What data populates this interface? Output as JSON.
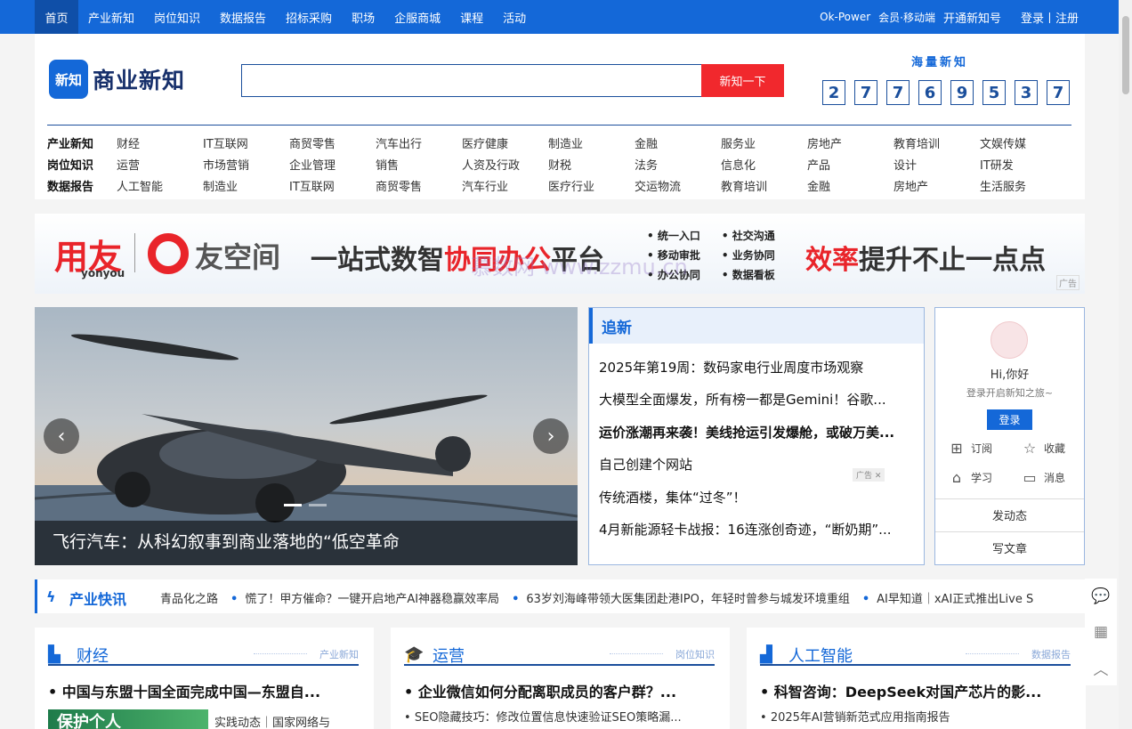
{
  "topnav": {
    "home": "首页",
    "links": [
      "产业新知",
      "岗位知识",
      "数据报告",
      "招标采购",
      "职场",
      "企服商城",
      "课程",
      "活动"
    ],
    "right": [
      "Ok-Power",
      "会员·移动端",
      "开通新知号"
    ],
    "login": "登录丨注册"
  },
  "logo": {
    "badge": "新知",
    "text": "商业新知"
  },
  "search": {
    "button": "新知一下",
    "placeholder": ""
  },
  "counter": {
    "title": "海量新知",
    "digits": [
      "2",
      "7",
      "7",
      "6",
      "9",
      "5",
      "3",
      "7"
    ]
  },
  "categories": [
    {
      "label": "产业新知",
      "items": [
        "财经",
        "IT互联网",
        "商贸零售",
        "汽车出行",
        "医疗健康",
        "制造业",
        "金融",
        "服务业",
        "房地产",
        "教育培训",
        "文娱传媒"
      ]
    },
    {
      "label": "岗位知识",
      "items": [
        "运营",
        "市场营销",
        "企业管理",
        "销售",
        "人资及行政",
        "财税",
        "法务",
        "信息化",
        "产品",
        "设计",
        "IT研发"
      ]
    },
    {
      "label": "数据报告",
      "items": [
        "人工智能",
        "制造业",
        "IT互联网",
        "商贸零售",
        "汽车行业",
        "医疗行业",
        "交运物流",
        "教育培训",
        "金融",
        "房地产",
        "生活服务"
      ]
    }
  ],
  "ad": {
    "brand": "用友",
    "brand_sub": "yonyou",
    "product": "友空间",
    "slogan_pre": "一站式数智",
    "slogan_em": "协同办公",
    "slogan_post": "平台",
    "bullets": [
      [
        "统一入口",
        "社交沟通"
      ],
      [
        "移动审批",
        "业务协同"
      ],
      [
        "办公协同",
        "数据看板"
      ]
    ],
    "eff_em": "效率",
    "eff_post": "提升不止一点点",
    "tag": "广告",
    "watermark": "慕数网 www.zzmu.cn"
  },
  "carousel": {
    "caption": "飞行汽车：从科幻叙事到商业落地的“低空革命"
  },
  "news": {
    "title": "追新",
    "items": [
      {
        "text": "2025年第19周：数码家电行业周度市场观察",
        "bold": false
      },
      {
        "text": "大模型全面爆发，所有榜一都是Gemini！谷歌...",
        "bold": false
      },
      {
        "text": "运价涨潮再来袭！美线抢运引发爆舱，或破万美...",
        "bold": true
      },
      {
        "text": "自己创建个网站",
        "bold": false
      },
      {
        "text": "传统酒楼，集体“过冬”！",
        "bold": false
      },
      {
        "text": "4月新能源轻卡战报：16连涨创奇迹，“断奶期”...",
        "bold": false
      }
    ],
    "ad_chip": "广告 ✕"
  },
  "user": {
    "greeting": "Hi,你好",
    "sub": "登录开启新知之旅~",
    "login": "登录",
    "actions": [
      "订阅",
      "收藏",
      "学习",
      "消息"
    ],
    "post": "发动态",
    "write": "写文章"
  },
  "flash": {
    "label": "产业快讯",
    "items": [
      "青品化之路",
      "慌了！甲方催命？一键开启地产AI神器稳赢效率局",
      "63岁刘海峰带领大医集团赴港IPO，年轻时曾参与城发环境重组",
      "AI早知道｜xAI正式推出Live S"
    ]
  },
  "columns": [
    {
      "name": "财经",
      "tag": "产业新知",
      "headline": "中国与东盟十国全面完成中国—东盟自...",
      "thumb": "保护个人",
      "sub": "实践动态｜国家网络与"
    },
    {
      "name": "运营",
      "tag": "岗位知识",
      "headline": "企业微信如何分配离职成员的客户群？...",
      "sub": "SEO隐藏技巧：修改位置信息快速验证SEO策略漏..."
    },
    {
      "name": "人工智能",
      "tag": "数据报告",
      "headline": "科智咨询：DeepSeek对国产芯片的影...",
      "sub": "2025年AI营销新范式应用指南报告"
    }
  ]
}
